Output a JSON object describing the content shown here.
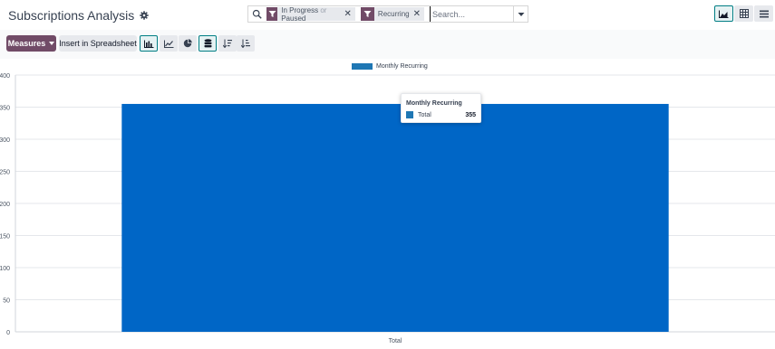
{
  "header": {
    "title": "Subscriptions Analysis"
  },
  "search": {
    "facets": [
      {
        "icon": "filter-icon",
        "part1": "In Progress",
        "or": "or",
        "part2": "Paused"
      },
      {
        "icon": "filter-icon",
        "label": "Recurring"
      }
    ],
    "placeholder": "Search..."
  },
  "toolbar": {
    "measures_label": "Measures",
    "insert_label": "Insert in Spreadsheet"
  },
  "colors": {
    "brand": "#714b67",
    "accent": "#017e84",
    "bar": "#0066c6"
  },
  "chart_data": {
    "type": "bar",
    "categories": [
      "Total"
    ],
    "series": [
      {
        "name": "Monthly Recurring",
        "values": [
          355
        ]
      }
    ],
    "ylim": [
      0,
      400
    ],
    "yticks": [
      0,
      50,
      100,
      150,
      200,
      250,
      300,
      350,
      400
    ],
    "grid": true,
    "legend_position": "top-center"
  },
  "tooltip": {
    "title": "Monthly Recurring",
    "label": "Total",
    "value": "355"
  }
}
